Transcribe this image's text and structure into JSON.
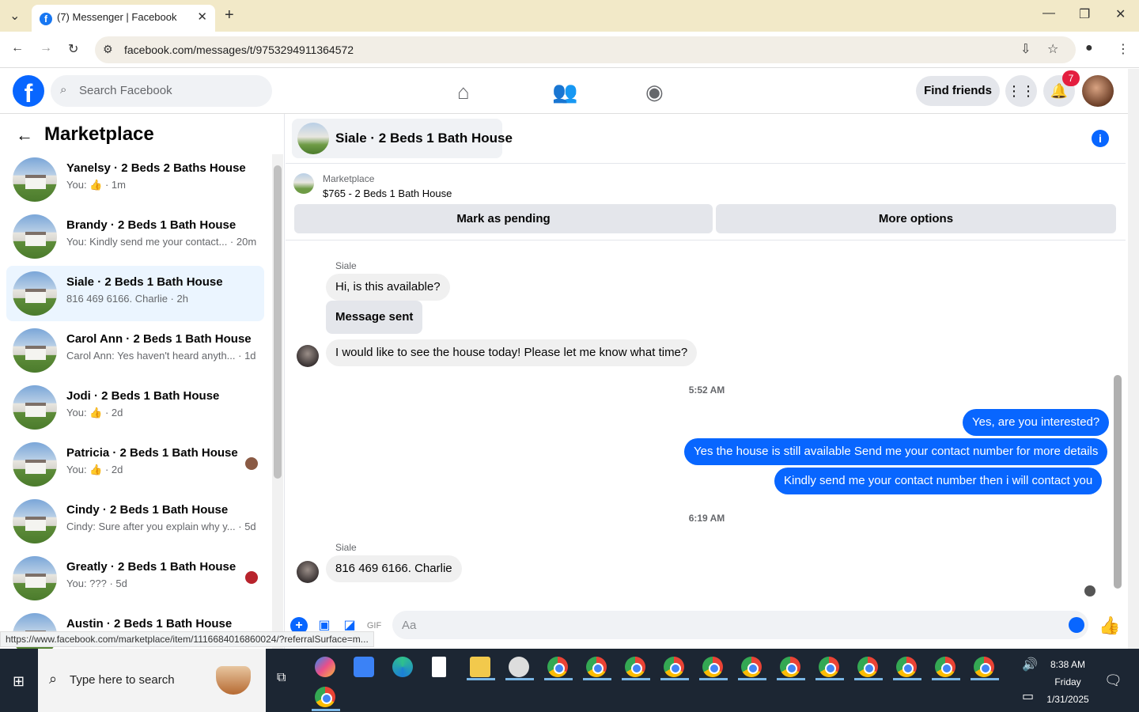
{
  "browser": {
    "tab_title": "(7) Messenger | Facebook",
    "url": "facebook.com/messages/t/9753294911364572",
    "status_url": "https://www.facebook.com/marketplace/item/1116684016860024/?referralSurface=m..."
  },
  "fb": {
    "search_placeholder": "Search Facebook",
    "find_friends": "Find friends",
    "notif_count": "7"
  },
  "sidebar": {
    "title": "Marketplace",
    "items": [
      {
        "name": "Yanelsy · 2 Beds 2 Baths House",
        "sub": "You: 👍 · 1m",
        "selected": false
      },
      {
        "name": "Brandy · 2 Beds 1 Bath House",
        "sub": "You: Kindly send me your contact... · 20m",
        "selected": false
      },
      {
        "name": "Siale · 2 Beds 1 Bath House",
        "sub": "816 469 6166. Charlie · 2h",
        "selected": true
      },
      {
        "name": "Carol Ann · 2 Beds 1 Bath House",
        "sub": "Carol Ann: Yes haven't heard anyth... · 1d",
        "selected": false
      },
      {
        "name": "Jodi · 2 Beds 1 Bath House",
        "sub": "You: 👍 · 2d",
        "selected": false
      },
      {
        "name": "Patricia · 2 Beds 1 Bath House",
        "sub": "You: 👍 · 2d",
        "selected": false
      },
      {
        "name": "Cindy · 2 Beds 1 Bath House",
        "sub": "Cindy: Sure after you explain why y... · 5d",
        "selected": false
      },
      {
        "name": "Greatly · 2 Beds 1 Bath House",
        "sub": "You: ??? · 5d",
        "selected": false
      },
      {
        "name": "Austin · 2 Beds 1 Bath House",
        "sub": "",
        "selected": false
      }
    ]
  },
  "chat": {
    "title": "Siale · 2 Beds 1 Bath House",
    "marketplace_label": "Marketplace",
    "listing": "$765 - 2 Beds 1 Bath House",
    "mark_pending": "Mark as pending",
    "more_options": "More options",
    "sender1": "Siale",
    "m1": "Hi, is this available?",
    "m2": "Message sent",
    "m3": "I would like to see the house today!  Please let me know what time?",
    "time1": "5:52 AM",
    "o1": "Yes, are you interested?",
    "o2": "Yes the house is still available Send me your contact number for more details",
    "o3": "Kindly send me your contact number then i will contact you",
    "time2": "6:19 AM",
    "sender2": "Siale",
    "m4": "816 469 6166. Charlie",
    "input_placeholder": "Aa"
  },
  "taskbar": {
    "search_placeholder": "Type here to search",
    "time": "8:38 AM",
    "day": "Friday",
    "date": "1/31/2025"
  }
}
